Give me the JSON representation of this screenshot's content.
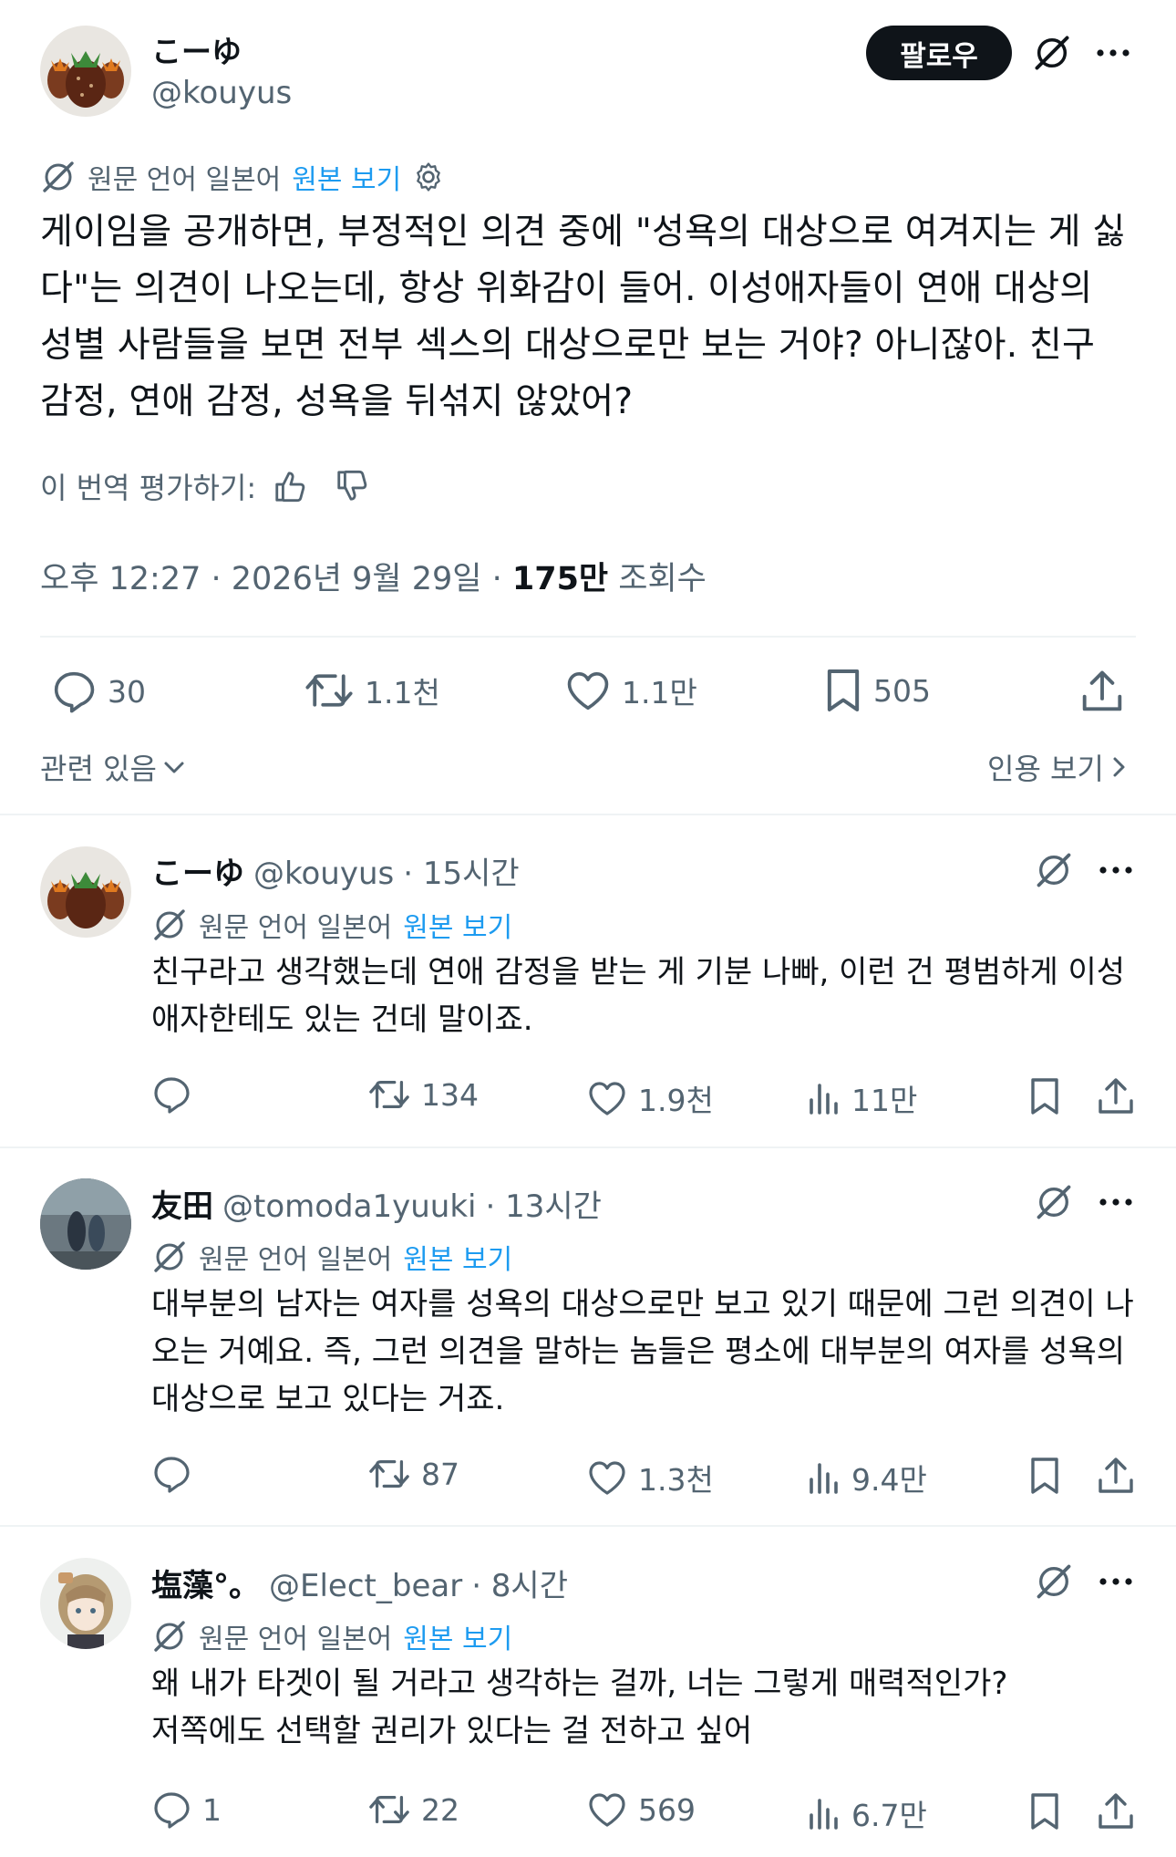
{
  "tweet": {
    "display_name": "こーゆ",
    "handle": "@kouyus",
    "follow_label": "팔로우",
    "translation": {
      "label": "원문 언어 일본어",
      "link": "원본 보기"
    },
    "text": "게이임을 공개하면, 부정적인 의견 중에 \"성욕의 대상으로 여겨지는 게 싫다\"는 의견이 나오는데, 항상 위화감이 들어. 이성애자들이 연애 대상의 성별 사람들을 보면 전부 섹스의 대상으로만 보는 거야? 아니잖아. 친구 감정, 연애 감정, 성욕을 뒤섞지 않았어?",
    "rate_label": "이 번역 평가하기:",
    "meta": {
      "time_date": "오후 12:27 · 2026년 9월 29일 · ",
      "views_count": "175만",
      "views_label": " 조회수"
    },
    "stats": {
      "replies": "30",
      "retweets": "1.1천",
      "likes": "1.1만",
      "bookmarks": "505"
    },
    "related_label": "관련 있음",
    "quotes_label": "인용 보기"
  },
  "replies": [
    {
      "display_name": "こーゆ",
      "handle": "@kouyus",
      "time": "· 15시간",
      "translation": {
        "label": "원문 언어 일본어",
        "link": "원본 보기"
      },
      "text": "친구라고 생각했는데 연애 감정을 받는 게 기분 나빠, 이런 건 평범하게 이성애자한테도 있는 건데 말이죠.",
      "stats": {
        "replies": "",
        "retweets": "134",
        "likes": "1.9천",
        "views": "11만"
      }
    },
    {
      "display_name": "友田",
      "handle": "@tomoda1yuuki",
      "time": "· 13시간",
      "translation": {
        "label": "원문 언어 일본어",
        "link": "원본 보기"
      },
      "text": "대부분의 남자는 여자를 성욕의 대상으로만 보고 있기 때문에 그런 의견이 나오는 거예요. 즉, 그런 의견을 말하는 놈들은 평소에 대부분의 여자를 성욕의 대상으로 보고 있다는 거죠.",
      "stats": {
        "replies": "",
        "retweets": "87",
        "likes": "1.3천",
        "views": "9.4만"
      }
    },
    {
      "display_name": "塩藻°。",
      "handle": "@Elect_bear",
      "time": "· 8시간",
      "translation": {
        "label": "원문 언어 일본어",
        "link": "원본 보기"
      },
      "text": "왜 내가 타겟이 될 거라고 생각하는 걸까, 너는 그렇게 매력적인가?\n저쪽에도 선택할 권리가 있다는 걸 전하고 싶어",
      "stats": {
        "replies": "1",
        "retweets": "22",
        "likes": "569",
        "views": "6.7만"
      }
    }
  ],
  "colors": {
    "text": "#0f1419",
    "secondary": "#536471",
    "link": "#1d9bf0",
    "divider": "#eff3f4"
  },
  "icons": [
    "grok-icon",
    "more-icon",
    "translate-icon",
    "gear-icon",
    "thumbs-up-icon",
    "thumbs-down-icon",
    "reply-icon",
    "retweet-icon",
    "like-icon",
    "bookmark-icon",
    "share-icon",
    "views-icon",
    "chevron-down-icon",
    "chevron-right-icon"
  ]
}
